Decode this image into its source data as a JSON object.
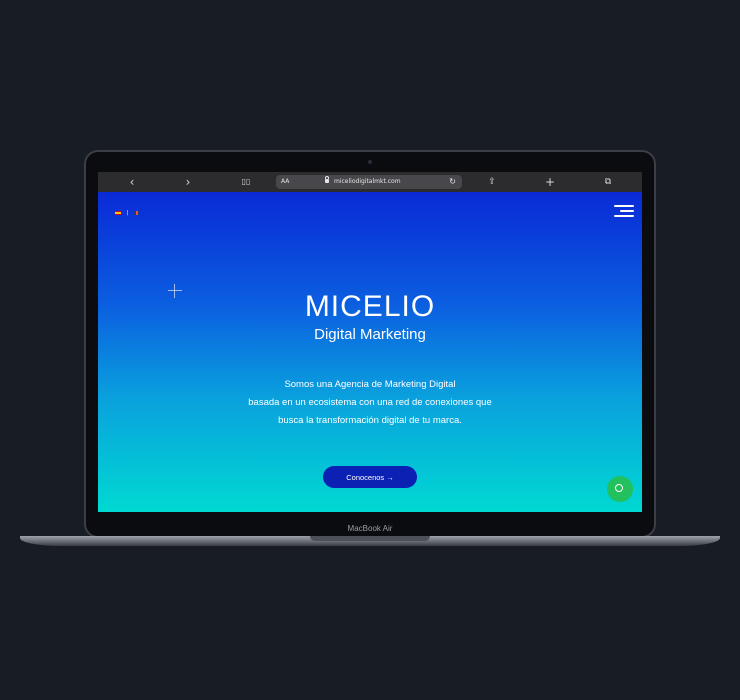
{
  "device": {
    "label": "MacBook Air"
  },
  "browser": {
    "back_icon": "‹",
    "forward_icon": "›",
    "bookmarks_icon": "▯▯",
    "text_size_label": "AA",
    "url": "miceliodigitalmkt.com",
    "reload_icon": "↻",
    "share_icon": "⇪",
    "new_tab_icon": "+",
    "tabs_icon": "⧉"
  },
  "site": {
    "language_separator": "|",
    "brand": "MICELIO",
    "brand_subtitle": "Digital Marketing",
    "description_lines": [
      "Somos una Agencia de Marketing Digital",
      "basada  en un ecosistema con una red de conexiones que",
      "busca  la transformación digital de tu marca."
    ],
    "cta_label": "Conocenos  →"
  },
  "colors": {
    "background": "#181c25",
    "gradient_top": "#0a2ad6",
    "gradient_bottom": "#00d9d2",
    "cta": "#0a21b4",
    "whatsapp": "#22c15e"
  }
}
